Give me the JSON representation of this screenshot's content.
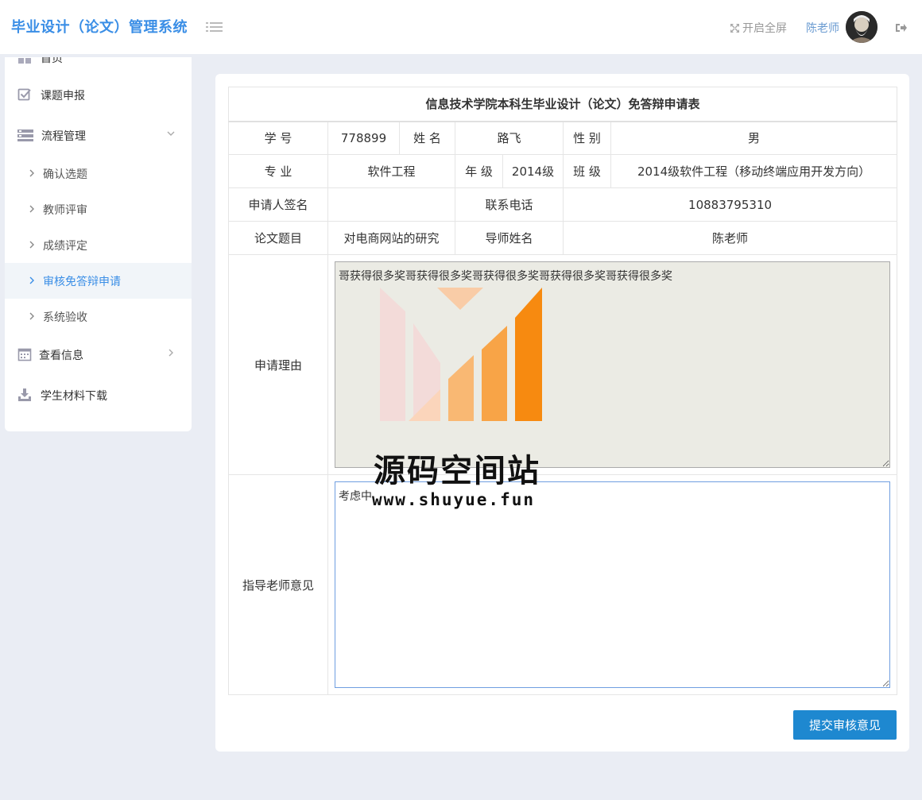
{
  "header": {
    "brand": "毕业设计（论文）管理系统",
    "fullscreen_label": "开启全屏",
    "username": "陈老师"
  },
  "sidebar": {
    "items": [
      {
        "label": "首页",
        "icon": "grid-icon"
      },
      {
        "label": "课题申报",
        "icon": "checkbox-icon"
      },
      {
        "label": "流程管理",
        "icon": "list-icon",
        "expanded": true
      },
      {
        "label": "查看信息",
        "icon": "calendar-icon"
      },
      {
        "label": "学生材料下载",
        "icon": "download-icon"
      }
    ],
    "sub_items": [
      {
        "label": "确认选题"
      },
      {
        "label": "教师评审"
      },
      {
        "label": "成绩评定"
      },
      {
        "label": "审核免答辩申请",
        "active": true
      },
      {
        "label": "系统验收"
      }
    ]
  },
  "form": {
    "title": "信息技术学院本科生毕业设计（论文）免答辩申请表",
    "student_id_label": "学 号",
    "student_id": "778899",
    "name_label": "姓 名",
    "name": "路飞",
    "gender_label": "性 别",
    "gender": "男",
    "major_label": "专 业",
    "major": "软件工程",
    "grade_label": "年 级",
    "grade": "2014级",
    "class_label": "班 级",
    "class": "2014级软件工程（移动终端应用开发方向）",
    "signature_label": "申请人签名",
    "signature": "",
    "phone_label": "联系电话",
    "phone": "10883795310",
    "thesis_label": "论文题目",
    "thesis": "对电商网站的研究",
    "advisor_label": "导师姓名",
    "advisor": "陈老师",
    "reason_label": "申请理由",
    "reason": "哥获得很多奖哥获得很多奖哥获得很多奖哥获得很多奖哥获得很多奖",
    "opinion_label": "指导老师意见",
    "opinion": "考虑中"
  },
  "submit_label": "提交审核意见",
  "watermark": {
    "title": "源码空间站",
    "url": "www.shuyue.fun"
  },
  "colors": {
    "brand": "#3a8ee6",
    "submit": "#1e88d0",
    "background": "#eaedf4"
  }
}
